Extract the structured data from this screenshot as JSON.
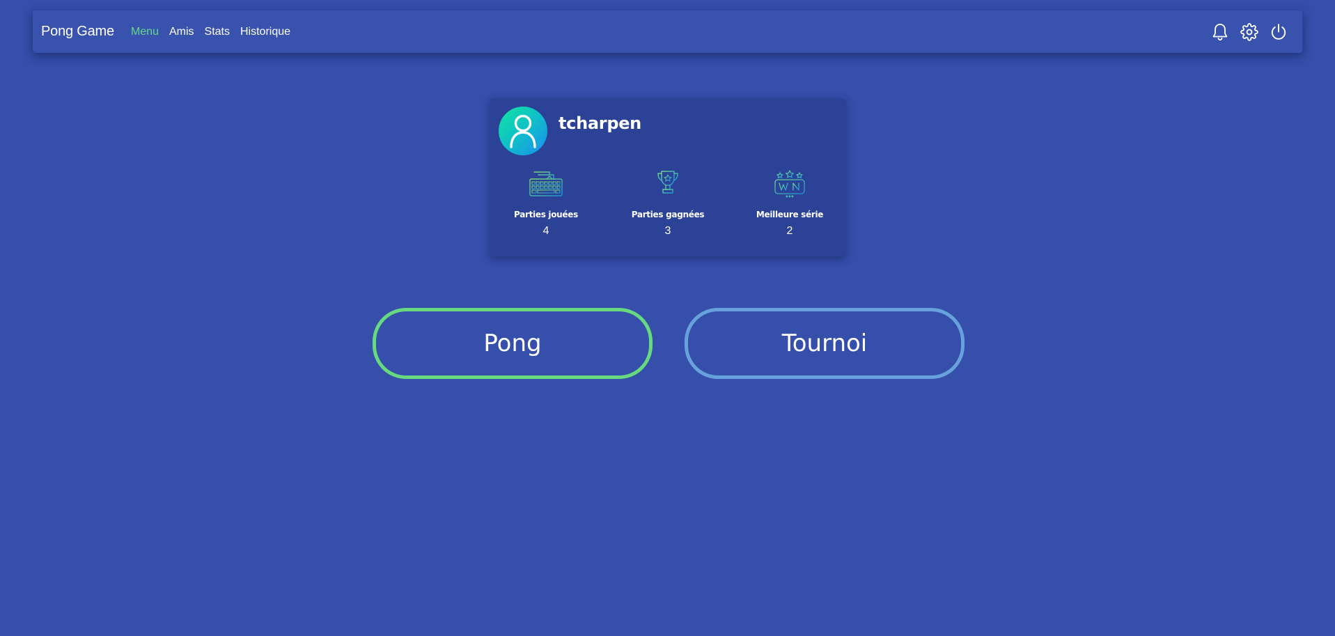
{
  "navbar": {
    "brand": "Pong Game",
    "links": [
      {
        "label": "Menu",
        "active": true
      },
      {
        "label": "Amis",
        "active": false
      },
      {
        "label": "Stats",
        "active": false
      },
      {
        "label": "Historique",
        "active": false
      }
    ],
    "icons": [
      "bell-icon",
      "gear-icon",
      "power-icon"
    ]
  },
  "profile": {
    "avatar_icon": "user-icon",
    "username": "tcharpen",
    "stats": [
      {
        "icon": "keyboard-icon",
        "label": "Parties jouées",
        "value": "4"
      },
      {
        "icon": "trophy-icon",
        "label": "Parties gagnées",
        "value": "3"
      },
      {
        "icon": "win-stars-icon",
        "label": "Meilleure série",
        "value": "2"
      }
    ]
  },
  "actions": {
    "pong_label": "Pong",
    "tournoi_label": "Tournoi"
  },
  "colors": {
    "background": "#354faa",
    "navbar": "#3852ad",
    "card": "#2b4297",
    "active_link": "#62d98a",
    "pong_border": "#67d97f",
    "tournoi_border": "#67a2dd"
  }
}
